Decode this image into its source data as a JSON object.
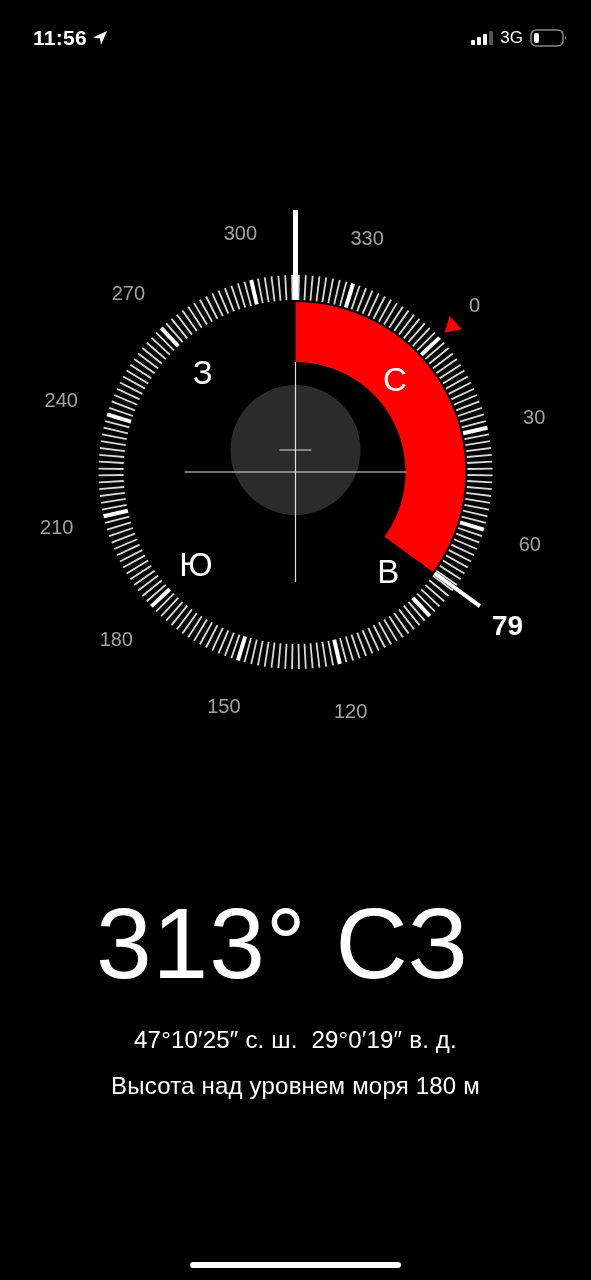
{
  "status_bar": {
    "time": "11:56",
    "network": "3G"
  },
  "compass": {
    "dial_labels": [
      {
        "text": "0"
      },
      {
        "text": "30"
      },
      {
        "text": "60"
      },
      {
        "text": "120"
      },
      {
        "text": "150"
      },
      {
        "text": "180"
      },
      {
        "text": "210"
      },
      {
        "text": "240"
      },
      {
        "text": "270"
      },
      {
        "text": "300"
      },
      {
        "text": "330"
      }
    ],
    "cardinals": [
      {
        "text": "З"
      },
      {
        "text": "С"
      },
      {
        "text": "Ю"
      },
      {
        "text": "В"
      }
    ],
    "target": {
      "label": "79"
    }
  },
  "heading": "313° СЗ",
  "coordinates": "47°10′25″ с. ш.  29°0′19″ в. д.",
  "altitude": "Высота над уровнем моря 180 м"
}
